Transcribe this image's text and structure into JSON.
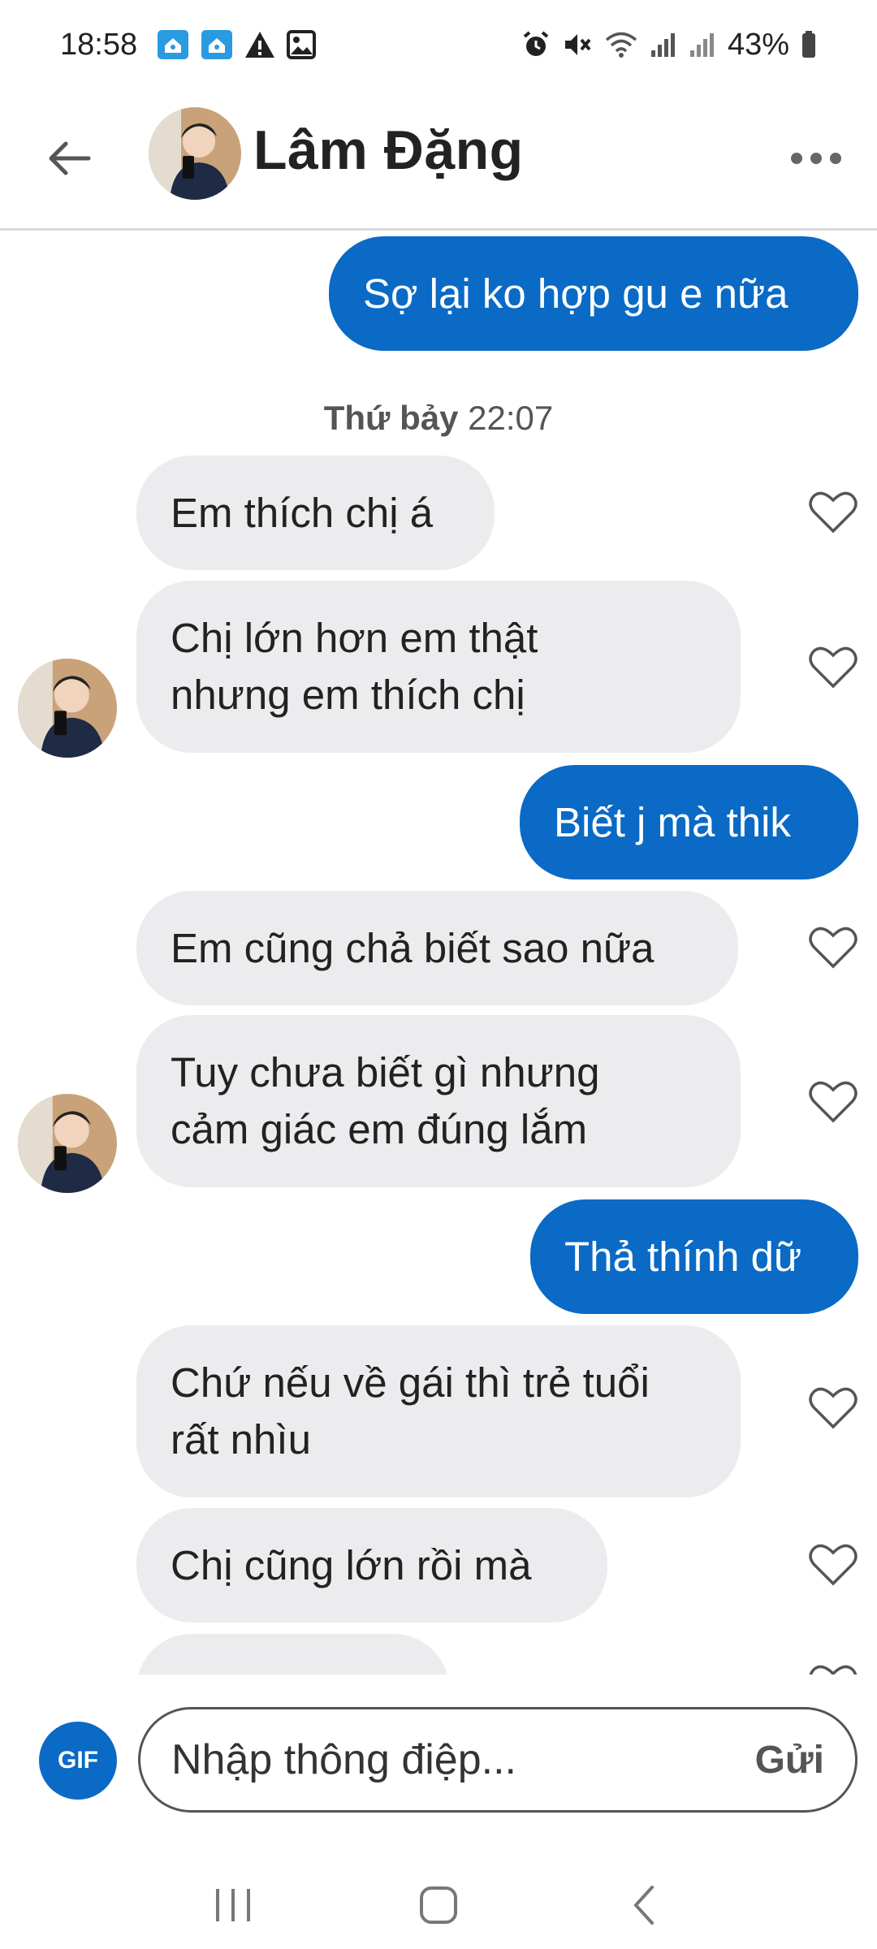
{
  "status_bar": {
    "time": "18:58",
    "battery": "43%",
    "left_icons": [
      "home-notification-icon",
      "home-notification-icon",
      "warning-icon",
      "image-icon"
    ],
    "right_icons": [
      "alarm-icon",
      "mute-icon",
      "wifi-icon",
      "signal-icon",
      "signal-icon",
      "battery-icon"
    ]
  },
  "header": {
    "contact_name": "Lâm Đặng"
  },
  "messages": {
    "m1": "Sợ lại ko hợp gu e nữa",
    "timestamp_day": "Thứ bảy",
    "timestamp_time": "22:07",
    "m2": "Em thích chị á",
    "m3_line1": "Chị lớn hơn em thật",
    "m3_line2": "nhưng em thích chị",
    "m4": "Biết j mà thik",
    "m5": "Em cũng chả biết sao nữa",
    "m6_line1": "Tuy chưa biết gì nhưng",
    "m6_line2": "cảm giác em đúng lắm",
    "m7": "Thả thính dữ",
    "m8_line1": "Chứ nếu về gái thì trẻ tuổi",
    "m8_line2": "rất nhìu",
    "m9": "Chị cũng lớn rồi mà"
  },
  "composer": {
    "gif_label": "GIF",
    "placeholder": "Nhập thông điệp...",
    "send_label": "Gửi"
  },
  "colors": {
    "accent": "#0a6ac5",
    "incoming_bubble": "#ececef"
  }
}
